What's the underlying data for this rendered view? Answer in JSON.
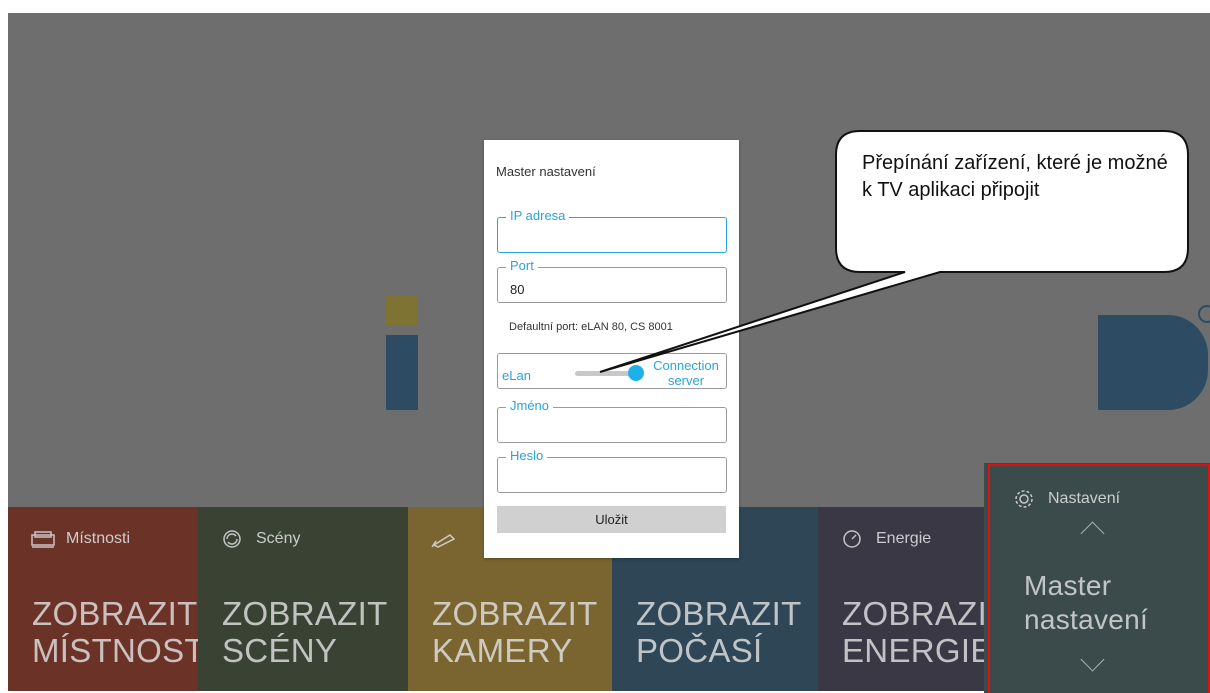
{
  "dialog": {
    "title": "Master nastavení",
    "ip_label": "IP adresa",
    "ip_value": "",
    "port_label": "Port",
    "port_value": "80",
    "hint": "Defaultní port: eLAN 80, CS 8001",
    "toggle_left": "eLan",
    "toggle_right": "Connection server",
    "name_label": "Jméno",
    "name_value": "",
    "password_label": "Heslo",
    "password_value": "",
    "save_label": "Uložit"
  },
  "tiles": [
    {
      "head": "Místnosti",
      "body1": "ZOBRAZIT",
      "body2": "MÍSTNOSTI",
      "icon": "bed-icon"
    },
    {
      "head": "Scény",
      "body1": "ZOBRAZIT",
      "body2": "SCÉNY",
      "icon": "refresh-icon"
    },
    {
      "head": "",
      "body1": "ZOBRAZIT",
      "body2": "KAMERY",
      "icon": "camera-icon"
    },
    {
      "head": "",
      "body1": "ZOBRAZIT",
      "body2": "POČASÍ",
      "icon": ""
    },
    {
      "head": "Energie",
      "body1": "ZOBRAZIT",
      "body2": "ENERGIE",
      "icon": "gauge-icon"
    },
    {
      "head": "Nastavení",
      "body1": "Master",
      "body2": "nastavení",
      "icon": "gear-icon"
    }
  ],
  "callout": {
    "text": "Přepínání zařízení, které je možné k TV aplikaci připojit"
  },
  "colors": {
    "accent": "#29a3d9",
    "knob": "#1fb0ea",
    "highlight": "#e01010"
  }
}
